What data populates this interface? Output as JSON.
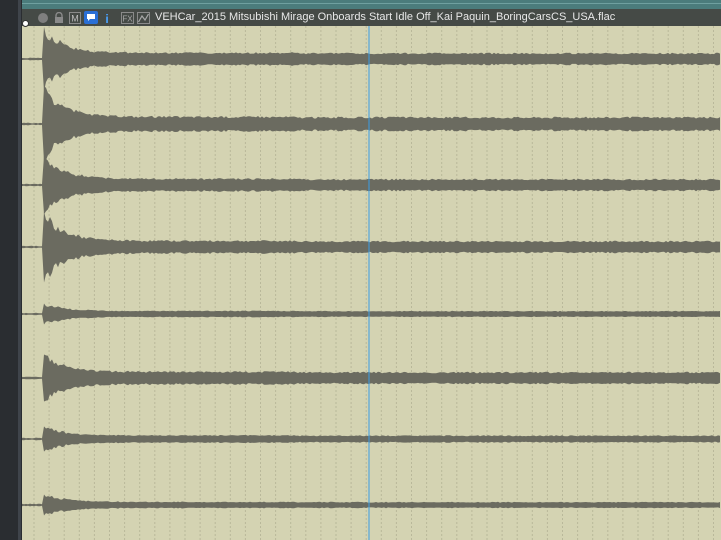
{
  "item": {
    "file_name": "VEHCar_2015 Mitsubishi Mirage Onboards Start Idle Off_Kai Paquin_BoringCarsCS_USA.flac",
    "buttons": [
      {
        "name": "lock-icon",
        "icon": "lock"
      },
      {
        "name": "mute-icon",
        "icon": "M"
      },
      {
        "name": "notes-icon",
        "icon": "speech-bubble"
      },
      {
        "name": "info-icon",
        "icon": "i"
      },
      {
        "name": "fx-icon",
        "icon": "FX"
      },
      {
        "name": "envelope-icon",
        "icon": "envelope"
      }
    ],
    "channel_count": 8
  },
  "colors": {
    "background": "#d4d3b2",
    "waveform": "#6b6b60",
    "header": "#454a46",
    "cursor": "#3a9ee6"
  }
}
